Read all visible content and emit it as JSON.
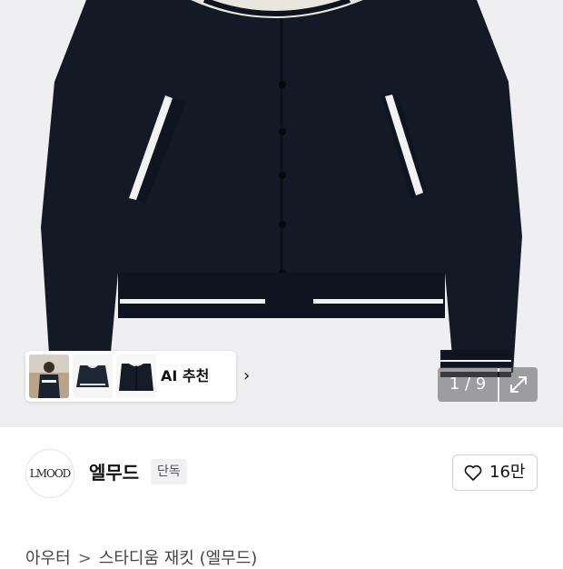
{
  "gallery": {
    "counter": "1 / 9",
    "expand_icon": "expand-icon"
  },
  "ai_recommend": {
    "label": "AI 추천",
    "chevron": "›"
  },
  "brand": {
    "name": "엘무드",
    "badge": "단독",
    "logo_text": "LMOOD",
    "like_count": "16만"
  },
  "breadcrumb": {
    "items": [
      "아우터",
      "스타디움 재킷 (엘무드)"
    ],
    "separator": ">"
  },
  "colors": {
    "jacket": "#131a26",
    "stripe": "#f2f2f2",
    "hero_bg": "#efeff1"
  }
}
